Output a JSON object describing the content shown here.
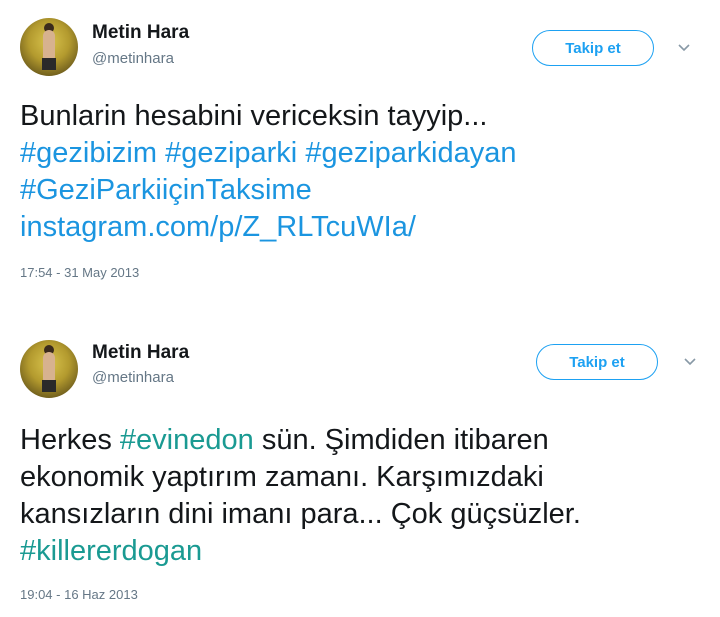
{
  "tweets": [
    {
      "author_name": "Metin Hara",
      "author_handle": "@metinhara",
      "follow_label": "Takip et",
      "text_line1": "Bunlarin hesabini vericeksin tayyip...",
      "hashtags": [
        "#gezibizim",
        "#geziparki",
        "#geziparkidayan",
        "#GeziParkiiçinTaksime"
      ],
      "link": "instagram.com/p/Z_RLTcuWIa/",
      "timestamp": "17:54 - 31 May 2013"
    },
    {
      "author_name": "Metin Hara",
      "author_handle": "@metinhara",
      "follow_label": "Takip et",
      "text_before_hashtag": "Herkes ",
      "inline_hashtag": "#evinedon",
      "text_after_hashtag": " sün. Şimdiden itibaren",
      "text_line2": "ekonomik yaptırım zamanı. Karşımızdaki",
      "text_line3": "kansızların dini imanı para... Çok güçsüzler.",
      "final_hashtag": "#killererdogan",
      "timestamp": "19:04 - 16 Haz 2013"
    }
  ],
  "colors": {
    "link_blue": "#1b95e0",
    "hashtag_teal": "#1a9a92",
    "button_blue": "#1da1f2",
    "muted_gray": "#657786"
  },
  "icons": {
    "menu": "chevron-down-icon"
  }
}
